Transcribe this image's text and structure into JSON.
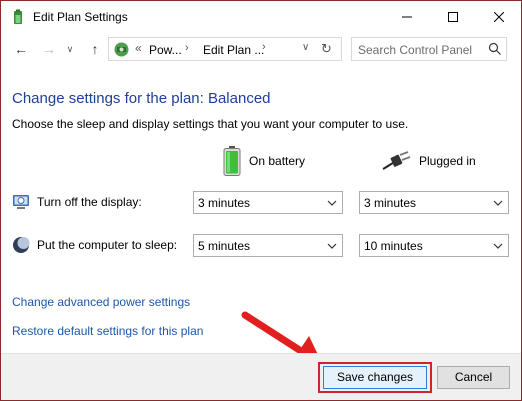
{
  "window": {
    "title": "Edit Plan Settings"
  },
  "nav": {
    "breadcrumb": [
      "Pow...",
      "Edit Plan ..."
    ],
    "search_placeholder": "Search Control Panel"
  },
  "main": {
    "heading": "Change settings for the plan: Balanced",
    "subtext": "Choose the sleep and display settings that you want your computer to use.",
    "columns": {
      "battery": "On battery",
      "plugged": "Plugged in"
    },
    "settings": [
      {
        "label": "Turn off the display:",
        "battery": "3 minutes",
        "plugged": "3 minutes"
      },
      {
        "label": "Put the computer to sleep:",
        "battery": "5 minutes",
        "plugged": "10 minutes"
      }
    ],
    "links": {
      "advanced": "Change advanced power settings",
      "restore": "Restore default settings for this plan"
    }
  },
  "footer": {
    "save": "Save changes",
    "cancel": "Cancel"
  },
  "colors": {
    "heading": "#1e3f9a",
    "link": "#1e56a8",
    "highlight": "#d2232a"
  }
}
